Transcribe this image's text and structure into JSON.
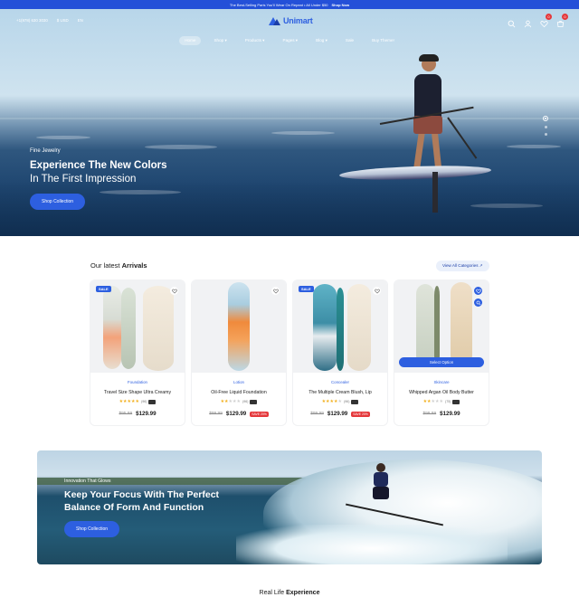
{
  "announcement": {
    "text": "The Best-Selling Paris You'll Wear On Repeat • All Under $50",
    "cta": "Shop Now"
  },
  "header": {
    "phone": "+1(978) 630 3030",
    "currency": "$ USD",
    "language": "EN",
    "brand": "Unimart",
    "wishlist_count": "0",
    "cart_count": "0"
  },
  "menu": [
    {
      "label": "Home"
    },
    {
      "label": "Shop ▾"
    },
    {
      "label": "Products ▾"
    },
    {
      "label": "Pages ▾"
    },
    {
      "label": "Blog ▾"
    },
    {
      "label": "Sale"
    },
    {
      "label": "Buy Theme!"
    }
  ],
  "hero": {
    "eyebrow": "Fine Jewelry",
    "title_line1": "Experience The New Colors",
    "title_line2": "In The First Impression",
    "button": "Shop Collection"
  },
  "arrivals": {
    "title_prefix": "Our latest",
    "title_bold": "Arrivals",
    "view_all": "View All Categories ↗",
    "products": [
      {
        "sale": "SALE",
        "category": "Foundation",
        "name": "Travel Size Shape Ultra Creamy",
        "reviews": "(96)",
        "old_price": "$95.99",
        "new_price": "$129.99",
        "save": "",
        "rating": 5
      },
      {
        "sale": "",
        "category": "Lotion",
        "name": "Oil-Free Liquid Foundation",
        "reviews": "(96)",
        "old_price": "$99.99",
        "new_price": "$129.99",
        "save": "SAVE 20%",
        "rating": 2
      },
      {
        "sale": "SALE",
        "category": "Concealer",
        "name": "The Multiple Cream Blush, Lip",
        "reviews": "(96)",
        "old_price": "$99.99",
        "new_price": "$129.99",
        "save": "SAVE 20%",
        "rating": 4
      },
      {
        "sale": "",
        "category": "Skincare",
        "name": "Whipped Argan Oil Body Butter",
        "reviews": "(75)",
        "old_price": "$99.99",
        "new_price": "$129.99",
        "save": "",
        "rating": 2,
        "select_option": "Select Option"
      }
    ]
  },
  "banner": {
    "eyebrow": "Innovation That Glows",
    "title_line1": "Keep Your Focus With The Perfect",
    "title_line2": "Balance Of Form And Function",
    "button": "Shop Collection"
  },
  "bottom_section": {
    "title_prefix": "Real Life",
    "title_bold": "Experience"
  },
  "colors": {
    "accent": "#2d5fe0",
    "sale_red": "#e5383b",
    "star": "#f2b01e"
  }
}
